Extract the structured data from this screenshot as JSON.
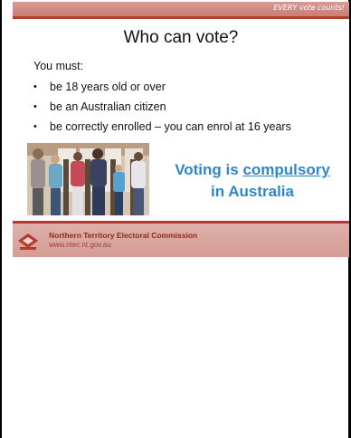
{
  "top_bar": {
    "tagline": "EVERY vote counts!"
  },
  "slide": {
    "title": "Who can vote?",
    "intro": "You must:",
    "bullets": [
      "be 18 years old or over",
      "be an Australian citizen",
      "be correctly enrolled – you can enrol at 16 years"
    ],
    "slogan": {
      "part1": "Voting is ",
      "underlined": "compulsory",
      "line2": "in Australia"
    }
  },
  "footer": {
    "organisation": "Northern Territory Electoral Commission",
    "url": "www.ntec.nt.gov.au"
  },
  "colors": {
    "accent_red": "#b6392f",
    "header_band": "#d89a92",
    "footer_band": "#d8a49c",
    "slogan_blue": "#2f86c9"
  },
  "icons": {
    "bullet": "bullet-dot-icon",
    "logo": "ntec-logo-icon",
    "photo": "voters-at-booths-photo"
  }
}
